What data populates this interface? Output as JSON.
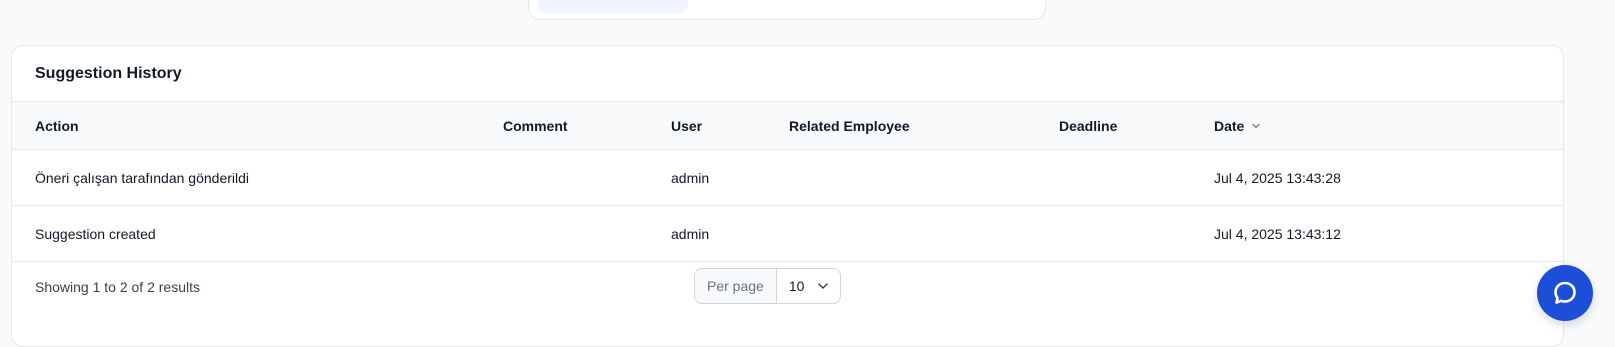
{
  "card": {
    "title": "Suggestion History"
  },
  "table": {
    "columns": [
      "Action",
      "Comment",
      "User",
      "Related Employee",
      "Deadline",
      "Date"
    ],
    "sort_icon": "chevron-down-icon",
    "rows": [
      {
        "action": "Öneri çalışan tarafından gönderildi",
        "comment": "",
        "user": "admin",
        "related_employee": "",
        "deadline": "",
        "date": "Jul 4, 2025 13:43:28"
      },
      {
        "action": "Suggestion created",
        "comment": "",
        "user": "admin",
        "related_employee": "",
        "deadline": "",
        "date": "Jul 4, 2025 13:43:12"
      }
    ]
  },
  "pagination": {
    "summary": "Showing 1 to 2 of 2 results",
    "per_page_label": "Per page",
    "per_page_value": "10"
  },
  "chat": {
    "icon": "chat-bubble-icon"
  },
  "colors": {
    "accent": "#1d4ed8",
    "border": "#e5e7eb",
    "header_bg": "#f9fafb"
  }
}
